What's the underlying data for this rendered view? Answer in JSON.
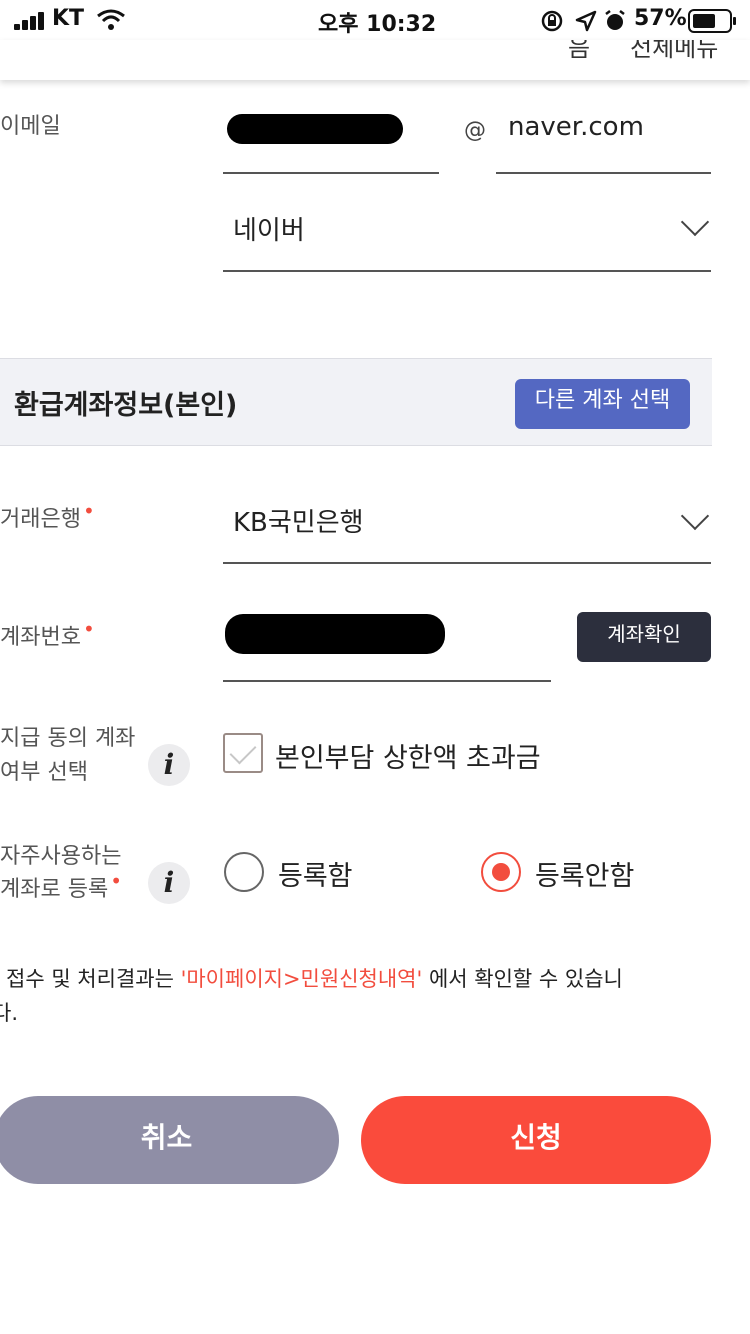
{
  "status_bar": {
    "carrier": "KT",
    "time": "오후 10:32",
    "battery": "57%"
  },
  "header": {
    "left_fragment": "음",
    "right_fragment": "전체메뉴"
  },
  "email": {
    "label": "이메일",
    "at": "@",
    "domain": "naver.com",
    "domain_select": "네이버"
  },
  "refund_section": {
    "title": "환급계좌정보(본인)",
    "other_account_button": "다른 계좌 선택"
  },
  "bank": {
    "label": "거래은행",
    "required_mark": "•",
    "value": "KB국민은행"
  },
  "account": {
    "label": "계좌번호",
    "required_mark": "•",
    "verify_button": "계좌확인"
  },
  "consent": {
    "label_line1": "지급 동의 계좌",
    "label_line2": "여부 선택",
    "info_icon": "i",
    "checkbox_label": "본인부담 상한액 초과금"
  },
  "frequent": {
    "label_line1": "자주사용하는",
    "label_line2": "계좌로 등록",
    "required_mark": "•",
    "info_icon": "i",
    "option_register": "등록함",
    "option_not_register": "등록안함",
    "selected": "등록안함"
  },
  "notice": {
    "prefix": "접수 및 처리결과는 ",
    "highlight": "'마이페이지>민원신청내역'",
    "suffix": " 에서 확인할 수 있습니",
    "line2": "다."
  },
  "actions": {
    "cancel": "취소",
    "apply": "신청"
  },
  "colors": {
    "accent": "#fa4b3c",
    "primary_blue": "#5468c2",
    "dark_button": "#2c2f3d",
    "cancel_gray": "#8f8ea6"
  }
}
